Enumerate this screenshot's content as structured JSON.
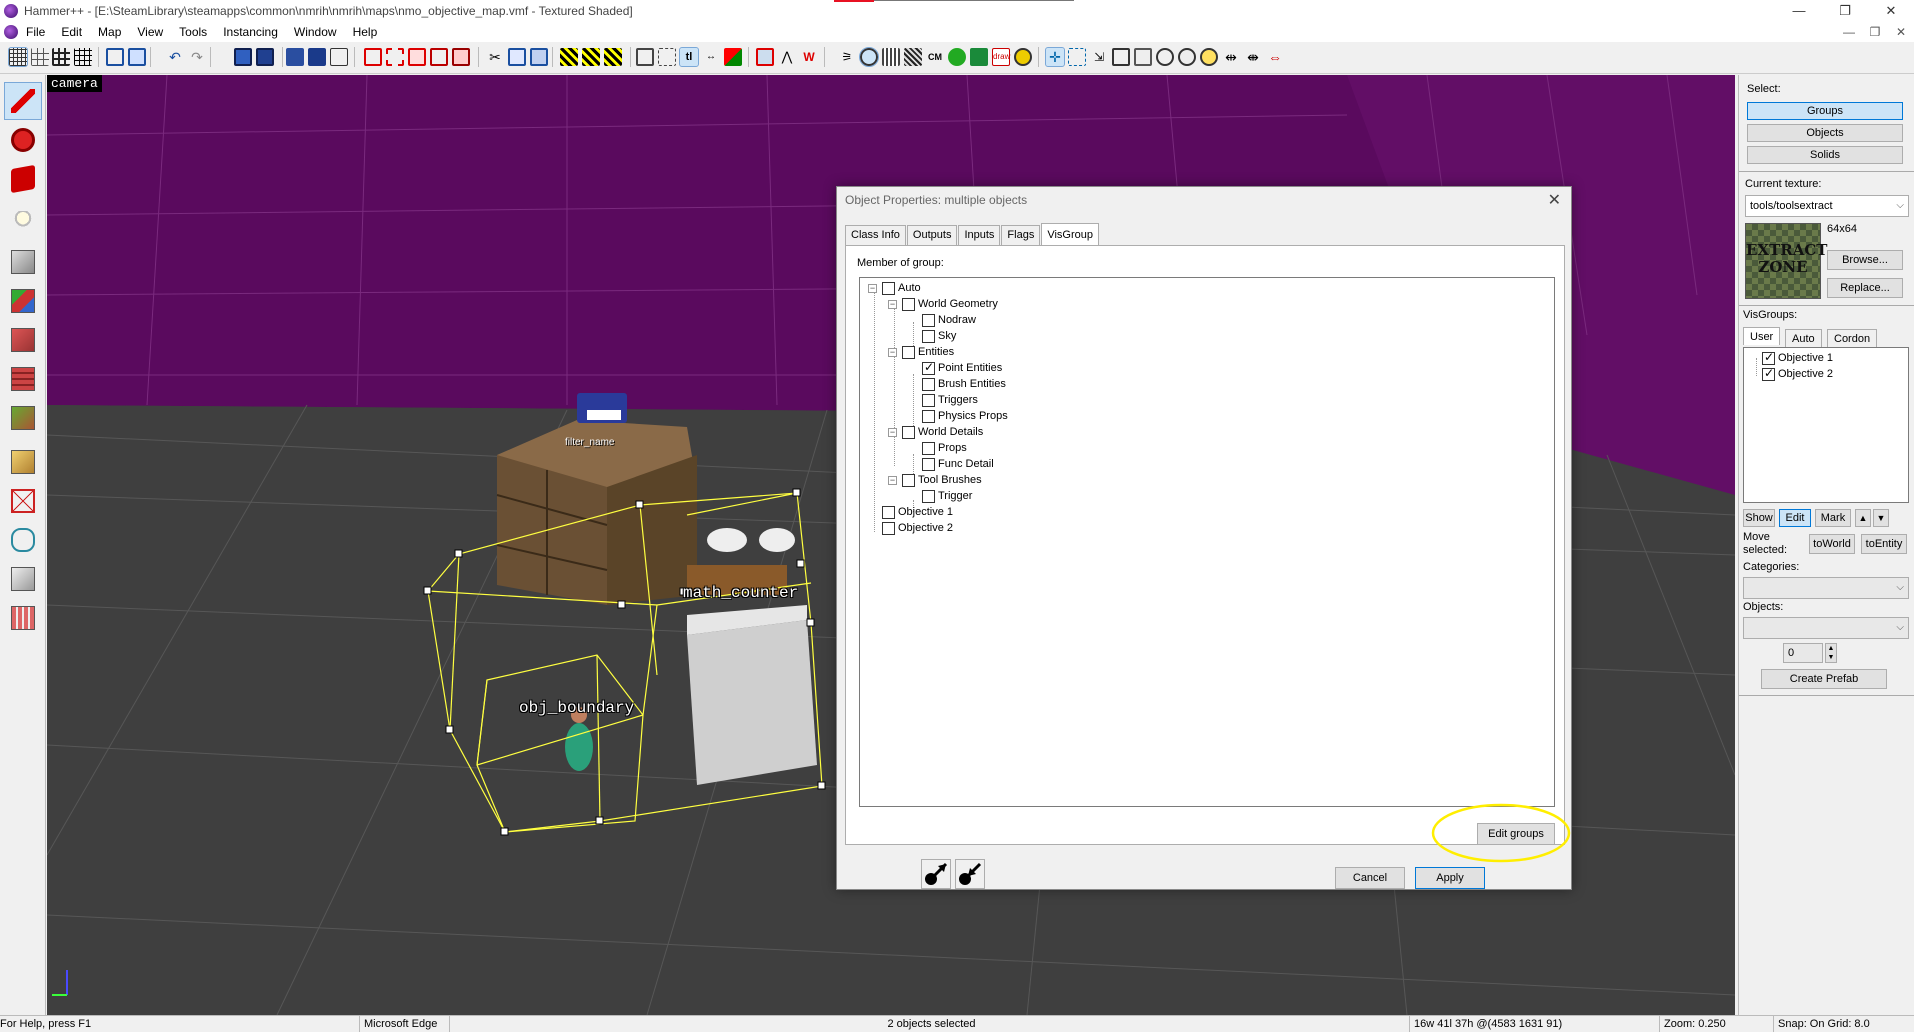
{
  "window": {
    "title": "Hammer++ - [E:\\SteamLibrary\\steamapps\\common\\nmrih\\nmrih\\maps\\nmo_objective_map.vmf - Textured Shaded]",
    "minimize": "—",
    "maximize": "❐",
    "close": "✕"
  },
  "menu": {
    "items": [
      "File",
      "Edit",
      "Map",
      "View",
      "Tools",
      "Instancing",
      "Window",
      "Help"
    ],
    "mdi_min": "—",
    "mdi_restore": "❐",
    "mdi_close": "✕"
  },
  "viewport": {
    "camera_label": "camera",
    "filter_name_label": "filter_name",
    "math_counter_label": "math_counter",
    "obj_boundary_label": "obj_boundary",
    "colors": {
      "sky": "#5a0a5e",
      "floor": "#3f3f3f",
      "selection": "#ffff40"
    }
  },
  "dialog": {
    "title": "Object Properties: multiple objects",
    "close": "✕",
    "tabs": [
      "Class Info",
      "Outputs",
      "Inputs",
      "Flags",
      "VisGroup"
    ],
    "active_tab": "VisGroup",
    "member_label": "Member of group:",
    "tree": [
      {
        "label": "Auto",
        "checked": false,
        "exp": "−"
      },
      {
        "label": "World Geometry",
        "checked": false,
        "exp": "−"
      },
      {
        "label": "Nodraw",
        "checked": false
      },
      {
        "label": "Sky",
        "checked": false
      },
      {
        "label": "Entities",
        "checked": false,
        "exp": "−"
      },
      {
        "label": "Point Entities",
        "checked": true
      },
      {
        "label": "Brush Entities",
        "checked": false
      },
      {
        "label": "Triggers",
        "checked": false
      },
      {
        "label": "Physics Props",
        "checked": false
      },
      {
        "label": "World Details",
        "checked": false,
        "exp": "−"
      },
      {
        "label": "Props",
        "checked": false
      },
      {
        "label": "Func Detail",
        "checked": false
      },
      {
        "label": "Tool Brushes",
        "checked": false,
        "exp": "−"
      },
      {
        "label": "Trigger",
        "checked": false
      },
      {
        "label": "Objective 1",
        "checked": false
      },
      {
        "label": "Objective 2",
        "checked": false
      }
    ],
    "edit_groups": "Edit groups",
    "cancel": "Cancel",
    "apply": "Apply"
  },
  "right_panel": {
    "select_label": "Select:",
    "groups": "Groups",
    "objects": "Objects",
    "solids": "Solids",
    "current_texture_label": "Current texture:",
    "texture_name": "tools/toolsextract",
    "texture_size": "64x64",
    "texture_preview_line1": "EXTRACT",
    "texture_preview_line2": "ZONE",
    "browse": "Browse...",
    "replace": "Replace...",
    "visgroups_label": "VisGroups:",
    "vis_tabs": [
      "User",
      "Auto",
      "Cordon"
    ],
    "vis_items": [
      {
        "label": "Objective 1",
        "checked": true
      },
      {
        "label": "Objective 2",
        "checked": true
      }
    ],
    "show": "Show",
    "edit": "Edit",
    "mark": "Mark",
    "up": "▲",
    "down": "▼",
    "move_selected": "Move selected:",
    "to_world": "toWorld",
    "to_entity": "toEntity",
    "categories_label": "Categories:",
    "objects_label": "Objects:",
    "spin_value": "0",
    "create_prefab": "Create Prefab"
  },
  "status": {
    "help": "For Help, press F1",
    "app": "Microsoft Edge",
    "selection": "2 objects selected",
    "size": "16w 41l 37h @(4583 1631 91)",
    "zoom": "Zoom: 0.250",
    "snap": "Snap: On Grid: 8.0"
  }
}
